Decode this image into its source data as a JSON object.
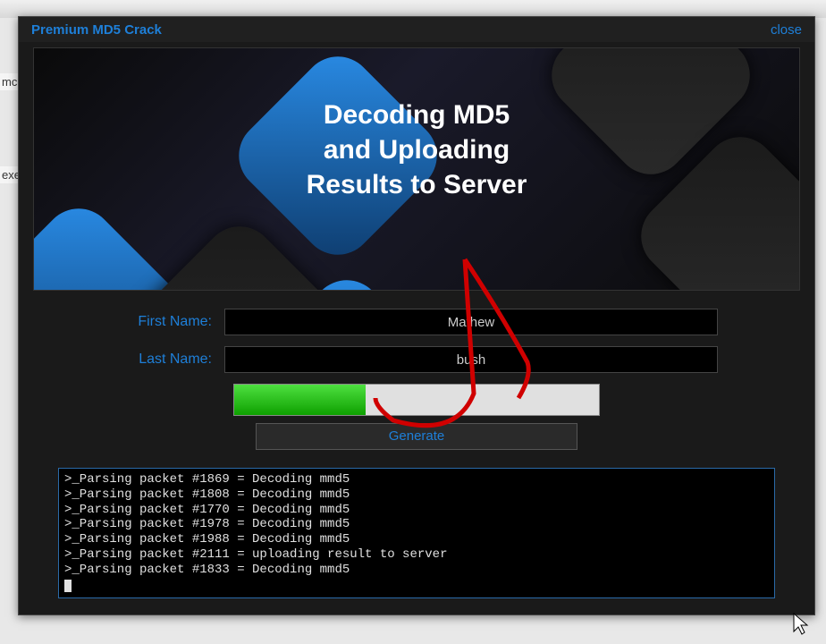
{
  "side": {
    "text1": "mc",
    "text2": "exe"
  },
  "window": {
    "title": "Premium MD5  Crack",
    "close": "close"
  },
  "hero": {
    "line1": "Decoding MD5",
    "line2": "and Uploading",
    "line3": "Results to Server"
  },
  "form": {
    "first_label": "First Name:",
    "first_value": "Mathew",
    "last_label": "Last Name:",
    "last_value": "bush"
  },
  "progress": {
    "percent": 36
  },
  "button": {
    "generate": "Generate"
  },
  "console": {
    "lines": [
      ">_Parsing packet #1869 = Decoding mmd5",
      ">_Parsing packet #1808 = Decoding mmd5",
      ">_Parsing packet #1770 = Decoding mmd5",
      ">_Parsing packet #1978 = Decoding mmd5",
      ">_Parsing packet #1988 = Decoding mmd5",
      ">_Parsing packet #2111 = uploading result to server",
      ">_Parsing packet #1833 = Decoding mmd5"
    ]
  }
}
